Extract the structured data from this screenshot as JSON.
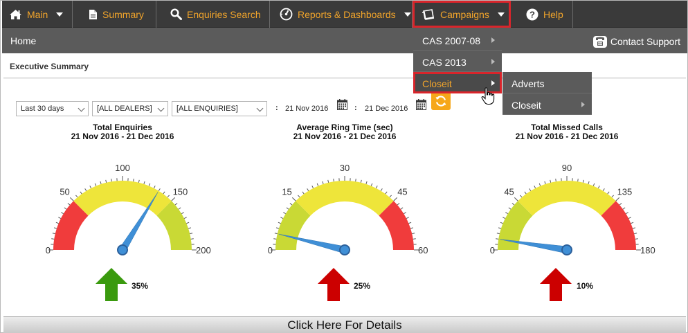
{
  "nav": {
    "main": "Main",
    "summary": "Summary",
    "enquiries_search": "Enquiries Search",
    "reports": "Reports & Dashboards",
    "campaigns": "Campaigns",
    "help": "Help"
  },
  "subbar": {
    "home": "Home",
    "contact_support": "Contact Support"
  },
  "page_title": "Executive Summary",
  "filters": {
    "period": "Last 30 days",
    "dealers": "[ALL DEALERS]",
    "enquiries": "[ALL ENQUIRIES]",
    "date_from": "21 Nov 2016",
    "date_to": "21 Dec 2016",
    "colon": ":"
  },
  "campaigns_menu": {
    "items": [
      {
        "label": "CAS 2007-08"
      },
      {
        "label": "CAS 2013"
      },
      {
        "label": "Closeit"
      }
    ],
    "submenu": [
      {
        "label": "Adverts"
      },
      {
        "label": "Closeit"
      }
    ]
  },
  "gauges": [
    {
      "title": "Total Enquiries",
      "subtitle": "21 Nov 2016 - 21 Dec 2016",
      "min": 0,
      "max": 200,
      "ticks": [
        "0",
        "50",
        "100",
        "150",
        "200"
      ],
      "value": 135,
      "bands": [
        {
          "from": 0,
          "to": 50,
          "color": "#f03c3c"
        },
        {
          "from": 50,
          "to": 150,
          "color": "#eee53a"
        },
        {
          "from": 150,
          "to": 200,
          "color": "#c9d935"
        }
      ],
      "change": "35%",
      "arrow_color": "#3a9a0e"
    },
    {
      "title": "Average Ring Time (sec)",
      "subtitle": "21 Nov 2016 - 21 Dec 2016",
      "min": 0,
      "max": 60,
      "ticks": [
        "0",
        "15",
        "30",
        "45",
        "60"
      ],
      "value": 4.5,
      "bands": [
        {
          "from": 0,
          "to": 15,
          "color": "#c9d935"
        },
        {
          "from": 15,
          "to": 45,
          "color": "#eee53a"
        },
        {
          "from": 45,
          "to": 60,
          "color": "#f03c3c"
        }
      ],
      "change": "25%",
      "arrow_color": "#cc0000"
    },
    {
      "title": "Total Missed Calls",
      "subtitle": "21 Nov 2016 - 21 Dec 2016",
      "min": 0,
      "max": 180,
      "ticks": [
        "0",
        "45",
        "90",
        "135",
        "180"
      ],
      "value": 9,
      "bands": [
        {
          "from": 0,
          "to": 45,
          "color": "#c9d935"
        },
        {
          "from": 45,
          "to": 135,
          "color": "#eee53a"
        },
        {
          "from": 135,
          "to": 180,
          "color": "#f03c3c"
        }
      ],
      "change": "10%",
      "arrow_color": "#cc0000"
    }
  ],
  "details_button": "Click Here For Details",
  "colors": {
    "accent": "#f2a52b",
    "nav_bg": "#3a3a3a",
    "subbar_bg": "#5b5b5b",
    "highlight": "#d9252b",
    "needle": "#3f8fd6"
  }
}
